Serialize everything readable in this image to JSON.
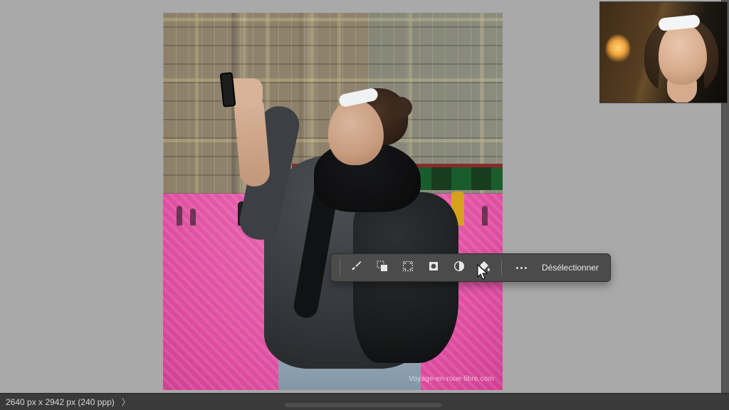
{
  "canvas": {
    "watermark": "Voyage-en-roue-libre.com"
  },
  "taskbar": {
    "icons": {
      "brush": "brush-icon",
      "subtract": "selection-subtract-icon",
      "expand": "selection-expand-icon",
      "invert": "selection-invert-icon",
      "feather": "feather-mask-icon",
      "fill": "fill-icon"
    },
    "more_label": "…",
    "deselect_label": "Désélectionner"
  },
  "statusbar": {
    "dimensions": "2640 px x 2942 px (240 ppp)",
    "chevron": "〉"
  }
}
